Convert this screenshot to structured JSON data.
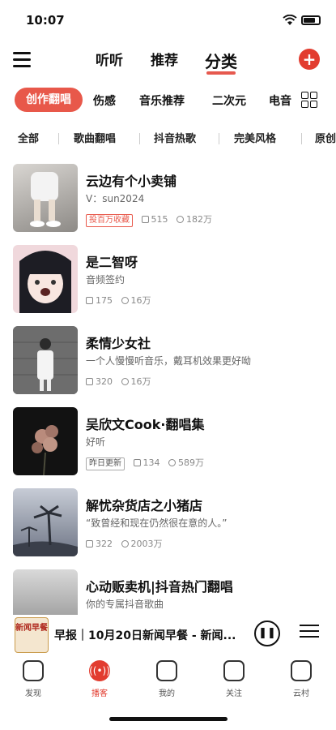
{
  "status": {
    "time": "10:07"
  },
  "header": {
    "tabs": [
      {
        "label": "听听"
      },
      {
        "label": "推荐"
      },
      {
        "label": "分类"
      }
    ],
    "add_label": "+"
  },
  "categories": {
    "primary": "创作翻唱",
    "items": [
      "伤感",
      "音乐推荐",
      "二次元",
      "电音"
    ]
  },
  "subcategories": [
    "全部",
    "歌曲翻唱",
    "抖音热歌",
    "完美风格",
    "原创"
  ],
  "items": [
    {
      "title": "云边有个小卖铺",
      "subtitle": "V：sun2024",
      "badge": "投百万收藏",
      "plays": "515",
      "count": "182万"
    },
    {
      "title": "是二智呀",
      "subtitle": "音频签约",
      "plays": "175",
      "count": "16万"
    },
    {
      "title": "柔情少女社",
      "subtitle": "一个人慢慢听音乐，戴耳机效果更好呦",
      "plays": "320",
      "count": "16万"
    },
    {
      "title": "吴欣文Cook·翻唱集",
      "subtitle": "好听",
      "badge": "昨日更新",
      "plays": "134",
      "count": "589万"
    },
    {
      "title": "解忧杂货店之小猪店",
      "subtitle": "“致曾经和现在仍然很在意的人。”",
      "plays": "322",
      "count": "2003万"
    },
    {
      "title": "心动贩卖机|抖音热门翻唱",
      "subtitle": "你的专属抖音歌曲"
    }
  ],
  "player": {
    "cover_text": "新闻早餐",
    "title": "早报｜10月20日新闻早餐 - 新闻..."
  },
  "tabbar": [
    {
      "label": "发现"
    },
    {
      "label": "播客"
    },
    {
      "label": "我的"
    },
    {
      "label": "关注"
    },
    {
      "label": "云村"
    }
  ]
}
